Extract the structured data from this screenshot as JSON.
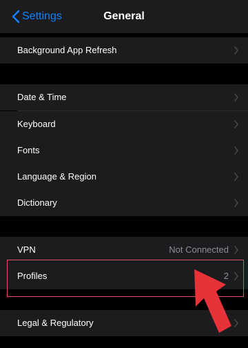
{
  "navbar": {
    "back_label": "Settings",
    "title": "General",
    "accent_color": "#0a84ff"
  },
  "sections": {
    "s1": {
      "rows": [
        {
          "label": "Background App Refresh",
          "detail": ""
        }
      ]
    },
    "s2": {
      "rows": [
        {
          "label": "Date & Time",
          "detail": ""
        },
        {
          "label": "Keyboard",
          "detail": ""
        },
        {
          "label": "Fonts",
          "detail": ""
        },
        {
          "label": "Language & Region",
          "detail": ""
        },
        {
          "label": "Dictionary",
          "detail": ""
        }
      ]
    },
    "s3": {
      "rows": [
        {
          "label": "VPN",
          "detail": "Not Connected"
        },
        {
          "label": "Profiles",
          "detail": "2"
        }
      ]
    },
    "s4": {
      "rows": [
        {
          "label": "Legal & Regulatory",
          "detail": ""
        }
      ]
    }
  },
  "annotation": {
    "highlight_color": "#e0506a",
    "arrow_color": "#e8323a"
  }
}
